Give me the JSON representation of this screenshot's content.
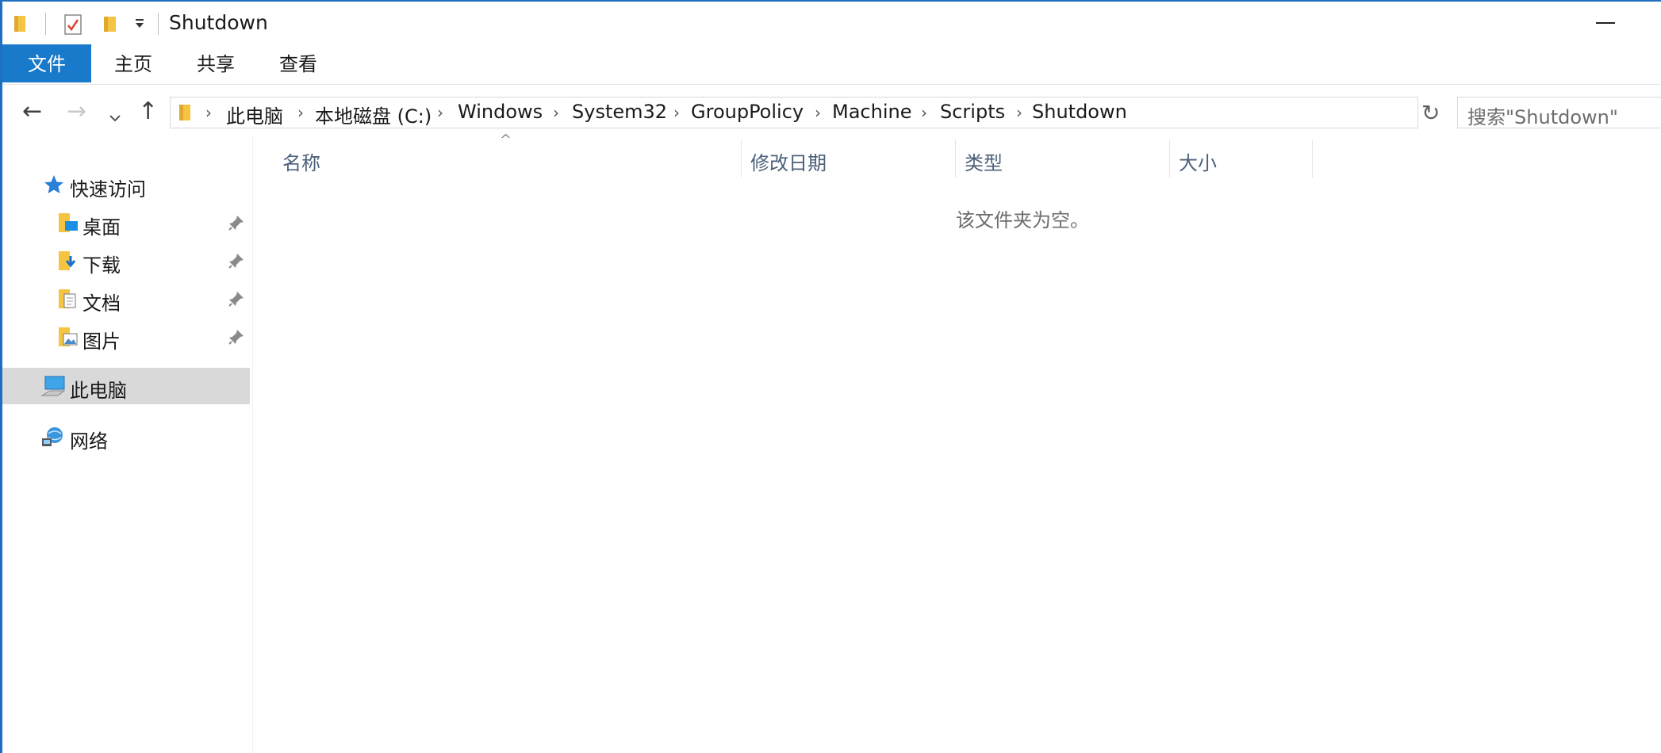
{
  "window": {
    "title": "Shutdown"
  },
  "ribbon": {
    "tabs": [
      {
        "label": "文件",
        "active": true
      },
      {
        "label": "主页",
        "active": false
      },
      {
        "label": "共享",
        "active": false
      },
      {
        "label": "查看",
        "active": false
      }
    ]
  },
  "address": {
    "crumbs": [
      "此电脑",
      "本地磁盘 (C:)",
      "Windows",
      "System32",
      "GroupPolicy",
      "Machine",
      "Scripts",
      "Shutdown"
    ]
  },
  "search": {
    "placeholder": "搜索\"Shutdown\""
  },
  "nav": {
    "quick_access": "快速访问",
    "pinned": [
      "桌面",
      "下载",
      "文档",
      "图片"
    ],
    "this_pc": "此电脑",
    "network": "网络"
  },
  "columns": [
    "名称",
    "修改日期",
    "类型",
    "大小"
  ],
  "content": {
    "empty_message": "该文件夹为空。"
  },
  "colors": {
    "accent": "#1979ca",
    "header_text": "#4c607a",
    "selected_bg": "#d9d9d9",
    "folder": "#f5c542"
  }
}
